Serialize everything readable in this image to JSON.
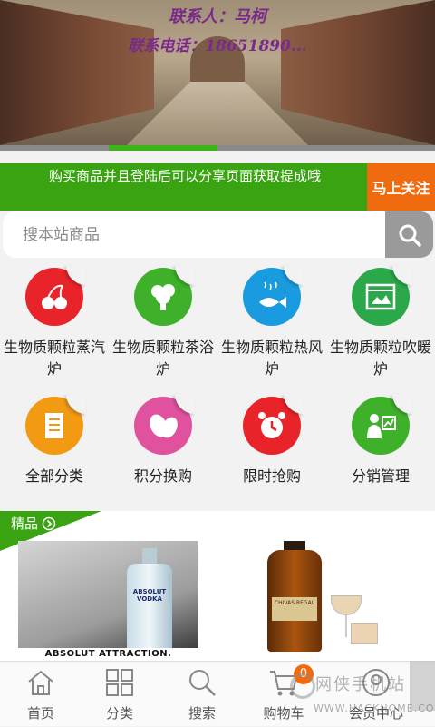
{
  "banner": {
    "contact_name": "联系人：马柯",
    "contact_phone": "联系电话：18651890..."
  },
  "share_bar": {
    "text": "购买商品并且登陆后可以分享页面获取提成哦",
    "follow_button": "马上关注"
  },
  "search": {
    "placeholder": "搜本站商品"
  },
  "categories": [
    {
      "label": "生物质颗粒蒸汽炉",
      "icon": "cherry-icon",
      "color": "#e8232a"
    },
    {
      "label": "生物质颗粒茶浴炉",
      "icon": "broccoli-icon",
      "color": "#3fb02a"
    },
    {
      "label": "生物质颗粒热风炉",
      "icon": "fish-icon",
      "color": "#1a9be0"
    },
    {
      "label": "生物质颗粒吹暖炉",
      "icon": "oven-icon",
      "color": "#2ba84a"
    },
    {
      "label": "全部分类",
      "icon": "document-list-icon",
      "color": "#f29a12"
    },
    {
      "label": "积分换购",
      "icon": "coffee-beans-icon",
      "color": "#e0529e"
    },
    {
      "label": "限时抢购",
      "icon": "alarm-clock-icon",
      "color": "#e8232a"
    },
    {
      "label": "分销管理",
      "icon": "presenter-icon",
      "color": "#3fb02a"
    }
  ],
  "featured": {
    "label": "精品",
    "products": [
      {
        "name": "ABSOLUT VODKA",
        "caption": "ABSOLUT ATTRACTION."
      },
      {
        "name": "CHIVAS REGAL"
      }
    ]
  },
  "tabbar": {
    "items": [
      {
        "label": "首页",
        "icon": "home-icon"
      },
      {
        "label": "分类",
        "icon": "grid-icon"
      },
      {
        "label": "搜索",
        "icon": "search-icon"
      },
      {
        "label": "购物车",
        "icon": "cart-icon",
        "badge": "0"
      },
      {
        "label": "会员中心",
        "icon": "user-icon"
      }
    ]
  },
  "watermark": {
    "text": "网侠手机站",
    "url": "WWW.HACKHOME.COM"
  }
}
